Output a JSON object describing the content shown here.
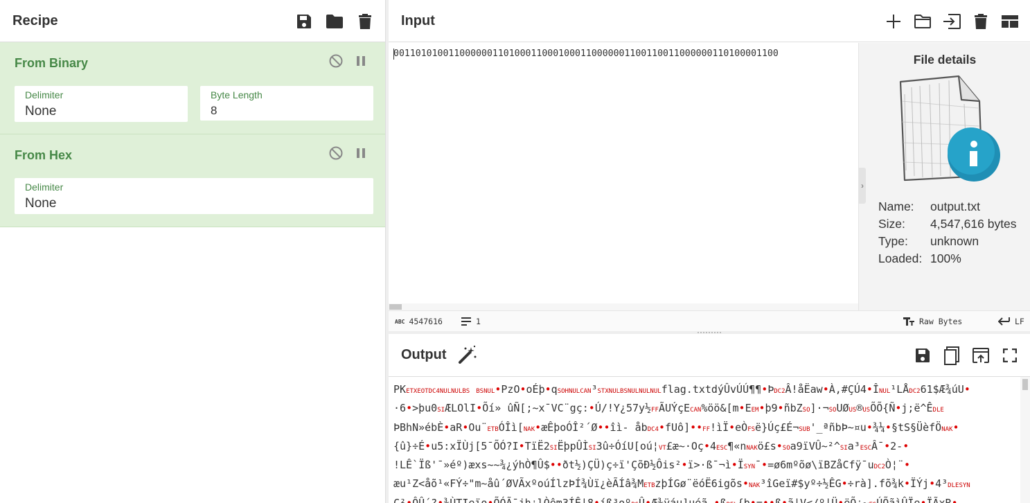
{
  "recipe": {
    "title": "Recipe",
    "icons": [
      "save-icon",
      "folder-icon",
      "trash-icon"
    ],
    "operations": [
      {
        "name": "From Binary",
        "args": [
          {
            "label": "Delimiter",
            "value": "None"
          },
          {
            "label": "Byte Length",
            "value": "8"
          }
        ]
      },
      {
        "name": "From Hex",
        "args": [
          {
            "label": "Delimiter",
            "value": "None"
          }
        ]
      }
    ]
  },
  "input": {
    "title": "Input",
    "icons": [
      "plus-icon",
      "folder-icon",
      "import-icon",
      "trash-icon",
      "layout-icon"
    ],
    "text": "0011010100110000001101000110001000110000001100110011000000110100001100",
    "status": {
      "length": "4547616",
      "lines": "1",
      "encoding": "Raw Bytes",
      "eol": "LF"
    }
  },
  "file_details": {
    "title": "File details",
    "name_label": "Name:",
    "name": "output.txt",
    "size_label": "Size:",
    "size": "4,547,616 bytes",
    "type_label": "Type:",
    "type": "unknown",
    "loaded_label": "Loaded:",
    "loaded": "100%"
  },
  "output": {
    "title": "Output",
    "icons": [
      "magic-wand-icon",
      "save-icon",
      "copy-icon",
      "replace-input-icon",
      "maximize-icon"
    ],
    "lines": [
      [
        [
          "t",
          "PK"
        ],
        [
          "c",
          "ETX"
        ],
        [
          "c",
          "EOT"
        ],
        [
          "c",
          "DC4"
        ],
        [
          "c",
          "NUL"
        ],
        [
          "c",
          "NUL"
        ],
        [
          "c",
          "BS"
        ],
        [
          "t",
          " "
        ],
        [
          "c",
          "BS"
        ],
        [
          "c",
          "NUL"
        ],
        [
          "d",
          ""
        ],
        [
          "t",
          "PzO"
        ],
        [
          "d",
          ""
        ],
        [
          "t",
          "oÉþ"
        ],
        [
          "d",
          ""
        ],
        [
          "t",
          "q"
        ],
        [
          "c",
          "SOH"
        ],
        [
          "c",
          "NUL"
        ],
        [
          "c",
          "CAN"
        ],
        [
          "t",
          "³"
        ],
        [
          "c",
          "STX"
        ],
        [
          "c",
          "NUL"
        ],
        [
          "c",
          "BS"
        ],
        [
          "c",
          "NUL"
        ],
        [
          "c",
          "NUL"
        ],
        [
          "c",
          "NUL"
        ],
        [
          "t",
          "flag.txtdýÛvÚÚ¶¶"
        ],
        [
          "d",
          ""
        ],
        [
          "t",
          "Þ"
        ],
        [
          "c",
          "DC2"
        ],
        [
          "t",
          "Â!åËaw"
        ],
        [
          "d",
          ""
        ],
        [
          "t",
          "À,#ÇÚ4"
        ],
        [
          "d",
          ""
        ],
        [
          "t",
          "Î"
        ],
        [
          "c",
          "NUL"
        ],
        [
          "t",
          "¹LÅ"
        ],
        [
          "c",
          "DC2"
        ],
        [
          "t",
          "61$Æ¾úU"
        ],
        [
          "d",
          ""
        ]
      ],
      [
        [
          "t",
          "·6"
        ],
        [
          "d",
          ""
        ],
        [
          "t",
          ">þu0"
        ],
        [
          "c",
          "SI"
        ],
        [
          "t",
          "ÆLOlI"
        ],
        [
          "d",
          ""
        ],
        [
          "t",
          "Õí»  ûÑ[;~x¯VC¨gç:"
        ],
        [
          "d",
          ""
        ],
        [
          "t",
          "Ú/!Y¿57y½"
        ],
        [
          "c",
          "FF"
        ],
        [
          "t",
          "ÃUÝçE"
        ],
        [
          "c",
          "CAN"
        ],
        [
          "t",
          "%öö&[m"
        ],
        [
          "d",
          ""
        ],
        [
          "t",
          "E"
        ],
        [
          "c",
          "EM"
        ],
        [
          "d",
          ""
        ],
        [
          "t",
          "þ9"
        ],
        [
          "d",
          ""
        ],
        [
          "t",
          "ñbZ"
        ],
        [
          "c",
          "SO"
        ],
        [
          "t",
          "]·¬"
        ],
        [
          "c",
          "SO"
        ],
        [
          "t",
          "UØ"
        ],
        [
          "c",
          "US"
        ],
        [
          "t",
          "®"
        ],
        [
          "c",
          "US"
        ],
        [
          "t",
          "ÕÕ{Ñ"
        ],
        [
          "d",
          ""
        ],
        [
          "t",
          "j;ë^Ê"
        ],
        [
          "c",
          "DLE"
        ]
      ],
      [
        [
          "t",
          "ÞBhN»ébÈ"
        ],
        [
          "d",
          ""
        ],
        [
          "t",
          "aR"
        ],
        [
          "d",
          ""
        ],
        [
          "t",
          "Ou¨"
        ],
        [
          "c",
          "ETB"
        ],
        [
          "t",
          "ÓÎì["
        ],
        [
          "c",
          "NAK"
        ],
        [
          "d",
          ""
        ],
        [
          "t",
          "æÊþoÓÎ²´Ø"
        ],
        [
          "d",
          ""
        ],
        [
          "d",
          ""
        ],
        [
          "t",
          "îì-  åb"
        ],
        [
          "c",
          "DC4"
        ],
        [
          "d",
          ""
        ],
        [
          "t",
          "fUô]"
        ],
        [
          "d",
          ""
        ],
        [
          "d",
          ""
        ],
        [
          "c",
          "FF"
        ],
        [
          "t",
          "!ìÏ"
        ],
        [
          "d",
          ""
        ],
        [
          "t",
          "eÒ"
        ],
        [
          "c",
          "FS"
        ],
        [
          "t",
          "ë}Úç£É¬"
        ],
        [
          "c",
          "SUB"
        ],
        [
          "t",
          "'_ªñbÞ~¤u"
        ],
        [
          "d",
          ""
        ],
        [
          "t",
          "¾¼"
        ],
        [
          "d",
          ""
        ],
        [
          "t",
          "§tS§ÜèfÖ"
        ],
        [
          "c",
          "NAK"
        ],
        [
          "d",
          ""
        ]
      ],
      [
        [
          "t",
          "{û}÷É"
        ],
        [
          "d",
          ""
        ],
        [
          "t",
          "u5:xÏÙj[5¯ÕÓ?I"
        ],
        [
          "d",
          ""
        ],
        [
          "t",
          "TïË2"
        ],
        [
          "c",
          "SI"
        ],
        [
          "t",
          "ËþpÛÌ"
        ],
        [
          "c",
          "SI"
        ],
        [
          "t",
          "3û÷ÓíU[oú¦"
        ],
        [
          "c",
          "VT"
        ],
        [
          "t",
          "£æ~·Oç"
        ],
        [
          "d",
          ""
        ],
        [
          "t",
          "4"
        ],
        [
          "c",
          "ESC"
        ],
        [
          "t",
          "¶«n"
        ],
        [
          "c",
          "NAK"
        ],
        [
          "t",
          "ö£s"
        ],
        [
          "d",
          ""
        ],
        [
          "c",
          "SO"
        ],
        [
          "t",
          "a9ïVÛ~²^"
        ],
        [
          "c",
          "SI"
        ],
        [
          "t",
          "a³"
        ],
        [
          "c",
          "ESC"
        ],
        [
          "t",
          "Â¯"
        ],
        [
          "d",
          ""
        ],
        [
          "t",
          "2-"
        ],
        [
          "d",
          ""
        ]
      ],
      [
        [
          "t",
          "!LÊ`Ïß'¯»éº)æxs~~¾¿ýhÒ¶Û$"
        ],
        [
          "d",
          ""
        ],
        [
          "d",
          ""
        ],
        [
          "t",
          "ðt½)ÇÜ)ç÷ï'ÇõÐ½Ôis²"
        ],
        [
          "d",
          ""
        ],
        [
          "t",
          "ï>·ß¯¬ì"
        ],
        [
          "d",
          ""
        ],
        [
          "t",
          "Ï"
        ],
        [
          "c",
          "SYN"
        ],
        [
          "t",
          "¯"
        ],
        [
          "d",
          ""
        ],
        [
          "t",
          "=ø6mºõø\\ïBZåCfÿ¯u"
        ],
        [
          "c",
          "DC2"
        ],
        [
          "t",
          "Ò¦¨"
        ],
        [
          "d",
          ""
        ]
      ],
      [
        [
          "t",
          "æu¹Z<åõ¹«FÝ÷\"m~åû´ØVÃxºoúÍlzÞÍ¾Ùï¿èÃÍâ¾M"
        ],
        [
          "c",
          "ETB"
        ],
        [
          "t",
          "zþÍGø¨ëóË6igõs"
        ],
        [
          "d",
          ""
        ],
        [
          "c",
          "NAK"
        ],
        [
          "t",
          "³îGeï#$yº÷½ÊG"
        ],
        [
          "d",
          ""
        ],
        [
          "t",
          "÷rà].fõ¾k"
        ],
        [
          "d",
          ""
        ],
        [
          "t",
          "ÏÝj"
        ],
        [
          "d",
          ""
        ],
        [
          "t",
          "4³"
        ],
        [
          "c",
          "DLE"
        ],
        [
          "c",
          "SYN"
        ]
      ],
      [
        [
          "t",
          "Ç²"
        ],
        [
          "d",
          ""
        ],
        [
          "t",
          "ÔÛ´?"
        ],
        [
          "d",
          ""
        ],
        [
          "t",
          "¾ÙTIeïo"
        ],
        [
          "d",
          ""
        ],
        [
          "t",
          "ÕÓÃ¯jh¿lÒêm3ÍÊ|8"
        ],
        [
          "d",
          ""
        ],
        [
          "t",
          "íß³oº"
        ],
        [
          "c",
          "BS"
        ],
        [
          "t",
          "Û"
        ],
        [
          "d",
          ""
        ],
        [
          "t",
          "Æ¾ÿáu]µéã,"
        ],
        [
          "d",
          ""
        ],
        [
          "t",
          "ß"
        ],
        [
          "c",
          "BEL"
        ],
        [
          "t",
          "{þ"
        ],
        [
          "d",
          ""
        ],
        [
          "t",
          "="
        ],
        [
          "d",
          ""
        ],
        [
          "d",
          ""
        ],
        [
          "t",
          "ß"
        ],
        [
          "d",
          ""
        ],
        [
          "t",
          "ã|V</º|Ü"
        ],
        [
          "d",
          ""
        ],
        [
          "t",
          "ëÕ¡~"
        ],
        [
          "c",
          "FS"
        ],
        [
          "t",
          "ÚÕãìÛÏe"
        ],
        [
          "d",
          ""
        ],
        [
          "t",
          "ÏÃxR"
        ],
        [
          "d",
          ""
        ]
      ]
    ]
  }
}
